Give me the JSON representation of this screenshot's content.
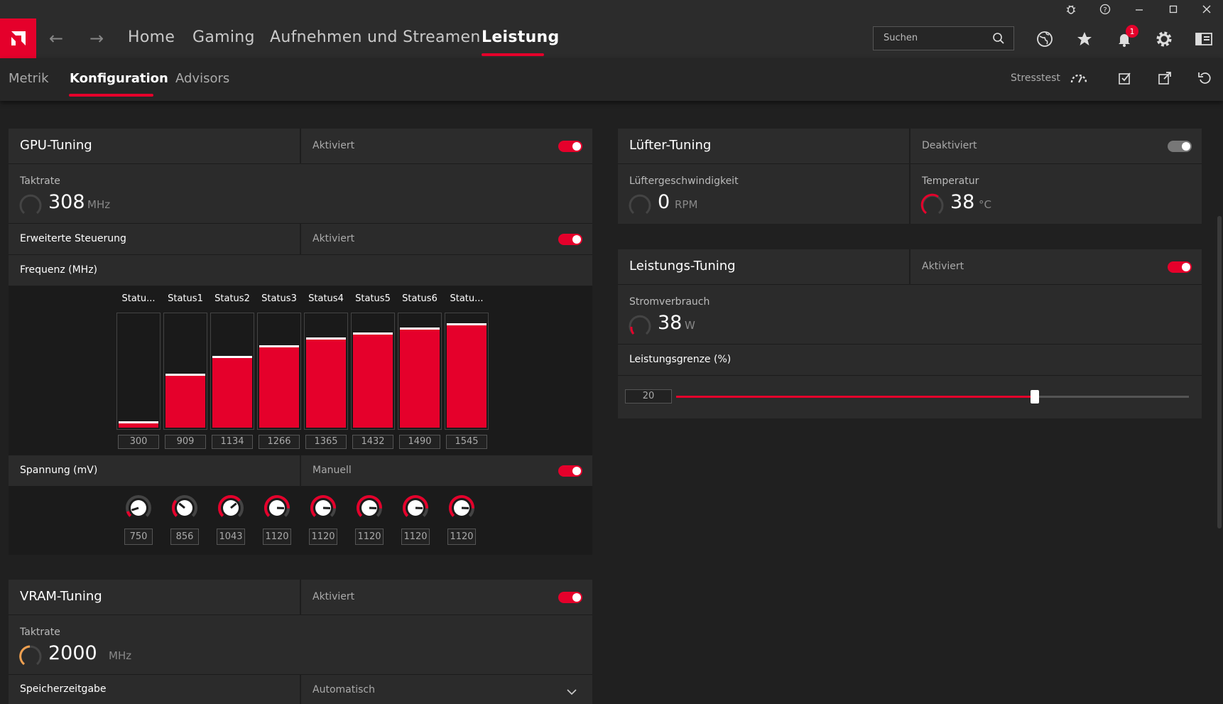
{
  "window": {
    "controls": [
      "bug-icon",
      "help-icon",
      "minimize-icon",
      "maximize-icon",
      "close-icon"
    ]
  },
  "nav": {
    "items": [
      {
        "label": "Home",
        "active": false
      },
      {
        "label": "Gaming",
        "active": false
      },
      {
        "label": "Aufnehmen und Streamen",
        "active": false
      },
      {
        "label": "Leistung",
        "active": true
      }
    ],
    "search_placeholder": "Suchen",
    "notification_count": "1"
  },
  "subnav": {
    "tabs": [
      {
        "label": "Metrik",
        "active": false
      },
      {
        "label": "Konfiguration",
        "active": true
      },
      {
        "label": "Advisors",
        "active": false
      }
    ],
    "stress_label": "Stresstest"
  },
  "gpu_tuning": {
    "title": "GPU-Tuning",
    "state": "Aktiviert",
    "enabled": true,
    "clock_label": "Taktrate",
    "clock_value": "308",
    "clock_unit": "MHz",
    "advanced_label": "Erweiterte Steuerung",
    "advanced_state": "Aktiviert",
    "freq_label": "Frequenz (MHz)",
    "states": [
      "Statu...",
      "Status1",
      "Status2",
      "Status3",
      "Status4",
      "Status5",
      "Status6",
      "Statu..."
    ],
    "freq_values": [
      300,
      909,
      1134,
      1266,
      1365,
      1432,
      1490,
      1545
    ],
    "voltage_label": "Spannung (mV)",
    "voltage_state": "Manuell",
    "voltage_values": [
      750,
      856,
      1043,
      1120,
      1120,
      1120,
      1120,
      1120
    ]
  },
  "vram_tuning": {
    "title": "VRAM-Tuning",
    "state": "Aktiviert",
    "clock_label": "Taktrate",
    "clock_value": "2000",
    "clock_unit": "MHz",
    "timing_label": "Speicherzeitgabe",
    "timing_value": "Automatisch"
  },
  "fan_tuning": {
    "title": "Lüfter-Tuning",
    "state": "Deaktiviert",
    "enabled": false,
    "speed_label": "Lüftergeschwindigkeit",
    "speed_value": "0",
    "speed_unit": "RPM",
    "temp_label": "Temperatur",
    "temp_value": "38",
    "temp_unit": "°C"
  },
  "power_tuning": {
    "title": "Leistungs-Tuning",
    "state": "Aktiviert",
    "enabled": true,
    "power_label": "Stromverbrauch",
    "power_value": "38",
    "power_unit": "W",
    "limit_label": "Leistungsgrenze (%)",
    "limit_value": "20",
    "limit_fraction": 0.7
  },
  "colors": {
    "accent": "#e5002b",
    "panel": "#2b2b2b",
    "background": "#202020"
  }
}
